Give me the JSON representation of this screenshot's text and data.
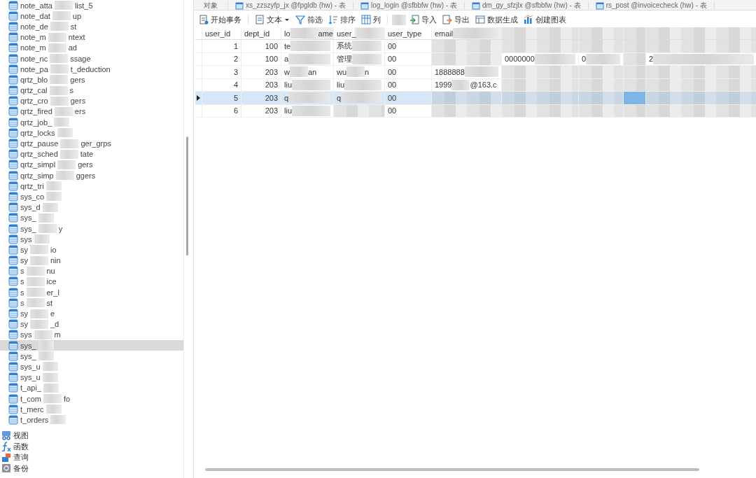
{
  "tabs": [
    {
      "label": "对象"
    },
    {
      "label": "xs_zzszyfp_jx @fpgldb (hw) - 表"
    },
    {
      "label": "log_login @sfbbfw (hw) - 表"
    },
    {
      "label": "dm_gy_sfzjlx @sfbbfw (hw) - 表"
    },
    {
      "label": "rs_post @invoicecheck (hw) - 表"
    }
  ],
  "sidebar": {
    "items": [
      {
        "label": [
          "note_atta",
          "list_5"
        ],
        "selected": false
      },
      {
        "label": [
          "note_dat",
          "up"
        ],
        "selected": false
      },
      {
        "label": [
          "note_de",
          "st"
        ],
        "selected": false
      },
      {
        "label": [
          "note_m",
          "ntext"
        ],
        "selected": false
      },
      {
        "label": [
          "note_m",
          "ad"
        ],
        "selected": false
      },
      {
        "label": [
          "note_nc",
          "ssage"
        ],
        "selected": false
      },
      {
        "label": [
          "note_pa",
          "t_deduction"
        ],
        "selected": false
      },
      {
        "label": [
          "qrtz_blo",
          "gers"
        ],
        "selected": false
      },
      {
        "label": [
          "qrtz_cal",
          "s"
        ],
        "selected": false
      },
      {
        "label": [
          "qrtz_cro",
          "gers"
        ],
        "selected": false
      },
      {
        "label": [
          "qrtz_fired",
          "ers"
        ],
        "selected": false
      },
      {
        "label": [
          "qrtz_job_"
        ],
        "selected": false
      },
      {
        "label": [
          "qrtz_locks"
        ],
        "selected": false
      },
      {
        "label": [
          "qrtz_pause",
          "ger_grps"
        ],
        "selected": false
      },
      {
        "label": [
          "qrtz_sched",
          "tate"
        ],
        "selected": false
      },
      {
        "label": [
          "qrtz_simpl",
          "gers"
        ],
        "selected": false
      },
      {
        "label": [
          "qrtz_simp",
          "ggers"
        ],
        "selected": false
      },
      {
        "label": [
          "qrtz_tri"
        ],
        "selected": false
      },
      {
        "label": [
          "sys_co"
        ],
        "selected": false
      },
      {
        "label": [
          "sys_d"
        ],
        "selected": false
      },
      {
        "label": [
          "sys_"
        ],
        "selected": false
      },
      {
        "label": [
          "sys_",
          "y"
        ],
        "selected": false
      },
      {
        "label": [
          "sys"
        ],
        "selected": false
      },
      {
        "label": [
          "sy",
          "io"
        ],
        "selected": false
      },
      {
        "label": [
          "sy",
          "nin"
        ],
        "selected": false
      },
      {
        "label": [
          "s",
          "nu"
        ],
        "selected": false
      },
      {
        "label": [
          "s",
          "ice"
        ],
        "selected": false
      },
      {
        "label": [
          "s",
          "er_l"
        ],
        "selected": false
      },
      {
        "label": [
          "s",
          "st"
        ],
        "selected": false
      },
      {
        "label": [
          "sy",
          "e"
        ],
        "selected": false
      },
      {
        "label": [
          "sy",
          "_d"
        ],
        "selected": false
      },
      {
        "label": [
          "sys",
          "m"
        ],
        "selected": false
      },
      {
        "label": [
          "sys_"
        ],
        "selected": true
      },
      {
        "label": [
          "sys_"
        ],
        "selected": false
      },
      {
        "label": [
          "sys_u"
        ],
        "selected": false
      },
      {
        "label": [
          "sys_u"
        ],
        "selected": false
      },
      {
        "label": [
          "t_api_"
        ],
        "selected": false
      },
      {
        "label": [
          "t_com",
          "fo"
        ],
        "selected": false
      },
      {
        "label": [
          "t_merc"
        ],
        "selected": false
      },
      {
        "label": [
          "t_orders"
        ],
        "selected": false
      }
    ],
    "categories": [
      {
        "label": "视图",
        "kind": "view"
      },
      {
        "label": "函数",
        "kind": "function"
      },
      {
        "label": "查询",
        "kind": "query"
      },
      {
        "label": "备份",
        "kind": "backup"
      }
    ]
  },
  "toolbar": [
    {
      "label": "开始事务",
      "kind": "transaction"
    },
    {
      "label": "文本",
      "kind": "text"
    },
    {
      "label": "筛选",
      "kind": "filter"
    },
    {
      "label": "排序",
      "kind": "sort"
    },
    {
      "label": "列",
      "kind": "columns"
    },
    {
      "label": "导入",
      "kind": "import"
    },
    {
      "label": "导出",
      "kind": "export"
    },
    {
      "label": "数据生成",
      "kind": "generate"
    },
    {
      "label": "创建图表",
      "kind": "chart"
    }
  ],
  "table": {
    "columns": [
      {
        "label": [
          "user_id"
        ],
        "kind": "number",
        "redacted": false
      },
      {
        "label": [
          "dept_id"
        ],
        "kind": "number",
        "redacted": false
      },
      {
        "label": [
          "lo",
          "ame"
        ],
        "kind": "text",
        "redacted": true
      },
      {
        "label": [
          "user_"
        ],
        "kind": "text",
        "redacted": true
      },
      {
        "label": [
          "user_type"
        ],
        "kind": "text",
        "redacted": false
      },
      {
        "label": [
          "email"
        ],
        "kind": "text",
        "redacted": true
      },
      {
        "kind": "number",
        "redacted": true
      },
      {
        "kind": "text",
        "redacted": true
      },
      {
        "kind": "text",
        "redacted": true
      },
      {
        "kind": "number",
        "redacted": true
      }
    ],
    "rows": [
      {
        "selected": false,
        "cells": [
          [
            "1"
          ],
          [
            "100"
          ],
          [
            "te"
          ],
          [
            "系统"
          ],
          [
            "00"
          ],
          [],
          [],
          [],
          [],
          []
        ]
      },
      {
        "selected": false,
        "cells": [
          [
            "2"
          ],
          [
            "100"
          ],
          [
            "a"
          ],
          [
            "管理"
          ],
          [
            "00"
          ],
          [],
          [
            "0000000"
          ],
          [
            "0"
          ],
          [],
          [
            "2"
          ]
        ]
      },
      {
        "selected": false,
        "cells": [
          [
            "3"
          ],
          [
            "203"
          ],
          [
            "w",
            "an"
          ],
          [
            "wu",
            "n"
          ],
          [
            "00"
          ],
          [
            "1888888"
          ],
          [],
          [],
          [],
          []
        ]
      },
      {
        "selected": false,
        "cells": [
          [
            "4"
          ],
          [
            "203"
          ],
          [
            "liu"
          ],
          [
            "liu"
          ],
          [
            "00"
          ],
          [
            "1999",
            "@163.c"
          ],
          [],
          [],
          [],
          []
        ]
      },
      {
        "selected": true,
        "cells": [
          [
            "5"
          ],
          [
            "203"
          ],
          [
            "q"
          ],
          [
            "q"
          ],
          [
            "00"
          ],
          [],
          [],
          [],
          [],
          []
        ]
      },
      {
        "selected": false,
        "cells": [
          [
            "6"
          ],
          [
            "203"
          ],
          [
            "liu"
          ],
          [],
          [
            "00"
          ],
          [],
          [],
          [],
          [],
          []
        ]
      }
    ]
  }
}
